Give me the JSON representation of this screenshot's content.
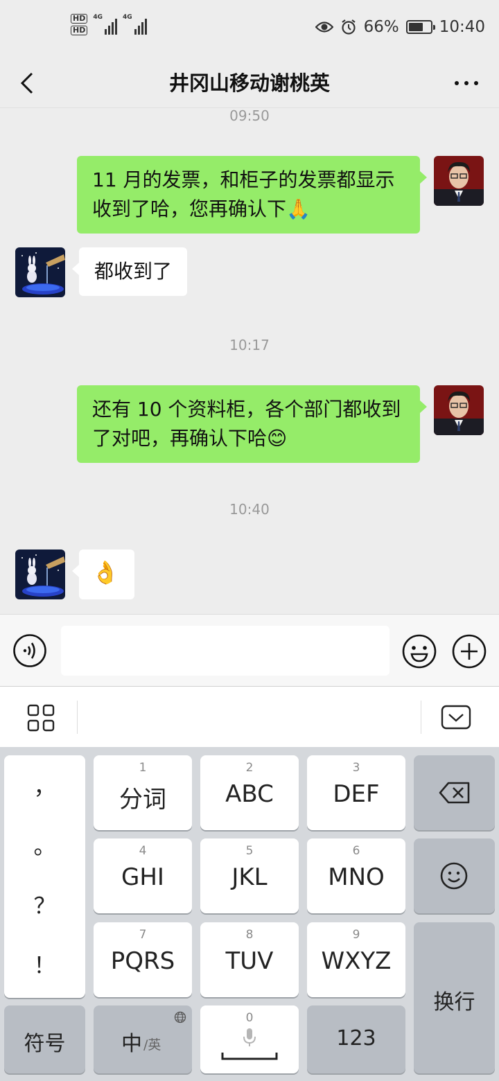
{
  "status_bar": {
    "hd1": "HD",
    "hd2": "HD",
    "sig1": "4G",
    "sig2": "4G",
    "battery_percent": "66%",
    "battery_level": 0.66,
    "time": "10:40",
    "icons": [
      "eye-icon",
      "alarm-icon"
    ]
  },
  "header": {
    "title": "井冈山移动谢桃英",
    "back_icon": "chevron-left-icon",
    "more_icon": "more-icon"
  },
  "messages": [
    {
      "type": "time",
      "text": "09:50"
    },
    {
      "type": "sent",
      "text": "11 月的发票，和柜子的发票都显示收到了哈，您再确认下🙏"
    },
    {
      "type": "received",
      "text": "都收到了"
    },
    {
      "type": "time",
      "text": "10:17"
    },
    {
      "type": "sent",
      "text": "还有 10 个资料柜，各个部门都收到了对吧，再确认下哈😊"
    },
    {
      "type": "time",
      "text": "10:40"
    },
    {
      "type": "received",
      "text": "👌"
    }
  ],
  "input_bar": {
    "placeholder": "",
    "icons": [
      "voice-icon",
      "emoji-icon",
      "plus-icon"
    ]
  },
  "keyboard": {
    "punctuation": [
      "，",
      "。",
      "？",
      "！"
    ],
    "keys": [
      {
        "num": "1",
        "label": "分词"
      },
      {
        "num": "2",
        "label": "ABC"
      },
      {
        "num": "3",
        "label": "DEF"
      },
      {
        "num": "4",
        "label": "GHI"
      },
      {
        "num": "5",
        "label": "JKL"
      },
      {
        "num": "6",
        "label": "MNO"
      },
      {
        "num": "7",
        "label": "PQRS"
      },
      {
        "num": "8",
        "label": "TUV"
      },
      {
        "num": "9",
        "label": "WXYZ"
      }
    ],
    "symbol_label": "符号",
    "lang_main": "中",
    "lang_alt": "/英",
    "space_num": "0",
    "num_label": "123",
    "enter_label": "换行"
  }
}
